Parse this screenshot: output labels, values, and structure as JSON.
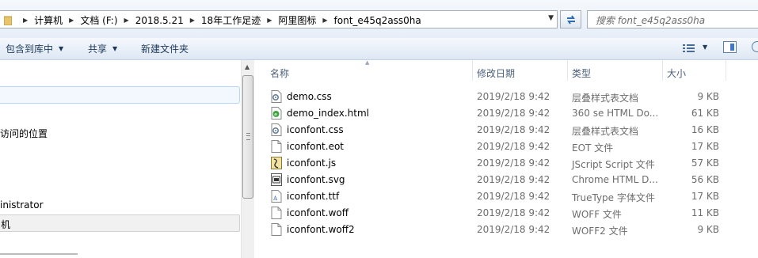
{
  "address_bar": {
    "breadcrumbs": [
      "计算机",
      "文档 (F:)",
      "2018.5.21",
      "18年工作足迹",
      "阿里图标",
      "font_e45q2ass0ha"
    ]
  },
  "search": {
    "placeholder": "搜索 font_e45q2ass0ha"
  },
  "toolbar": {
    "include_library": "包含到库中",
    "share": "共享",
    "new_folder": "新建文件夹"
  },
  "nav_pane": {
    "items": [
      {
        "label": "访问的位置"
      },
      {
        "label": "inistrator"
      },
      {
        "label": "机"
      }
    ]
  },
  "columns": {
    "name": "名称",
    "date": "修改日期",
    "type": "类型",
    "size": "大小"
  },
  "files": [
    {
      "name": "demo.css",
      "date": "2019/2/18 9:42",
      "type": "层叠样式表文档",
      "size": "9 KB",
      "icon": "css-file-icon"
    },
    {
      "name": "demo_index.html",
      "date": "2019/2/18 9:42",
      "type": "360 se HTML Do...",
      "size": "61 KB",
      "icon": "html-file-icon"
    },
    {
      "name": "iconfont.css",
      "date": "2019/2/18 9:42",
      "type": "层叠样式表文档",
      "size": "16 KB",
      "icon": "css-file-icon"
    },
    {
      "name": "iconfont.eot",
      "date": "2019/2/18 9:42",
      "type": "EOT 文件",
      "size": "17 KB",
      "icon": "blank-file-icon"
    },
    {
      "name": "iconfont.js",
      "date": "2019/2/18 9:42",
      "type": "JScript Script 文件",
      "size": "57 KB",
      "icon": "js-file-icon"
    },
    {
      "name": "iconfont.svg",
      "date": "2019/2/18 9:42",
      "type": "Chrome HTML D...",
      "size": "56 KB",
      "icon": "svg-file-icon"
    },
    {
      "name": "iconfont.ttf",
      "date": "2019/2/18 9:42",
      "type": "TrueType 字体文件",
      "size": "17 KB",
      "icon": "font-file-icon"
    },
    {
      "name": "iconfont.woff",
      "date": "2019/2/18 9:42",
      "type": "WOFF 文件",
      "size": "11 KB",
      "icon": "blank-file-icon"
    },
    {
      "name": "iconfont.woff2",
      "date": "2019/2/18 9:42",
      "type": "WOFF2 文件",
      "size": "9 KB",
      "icon": "blank-file-icon"
    }
  ]
}
